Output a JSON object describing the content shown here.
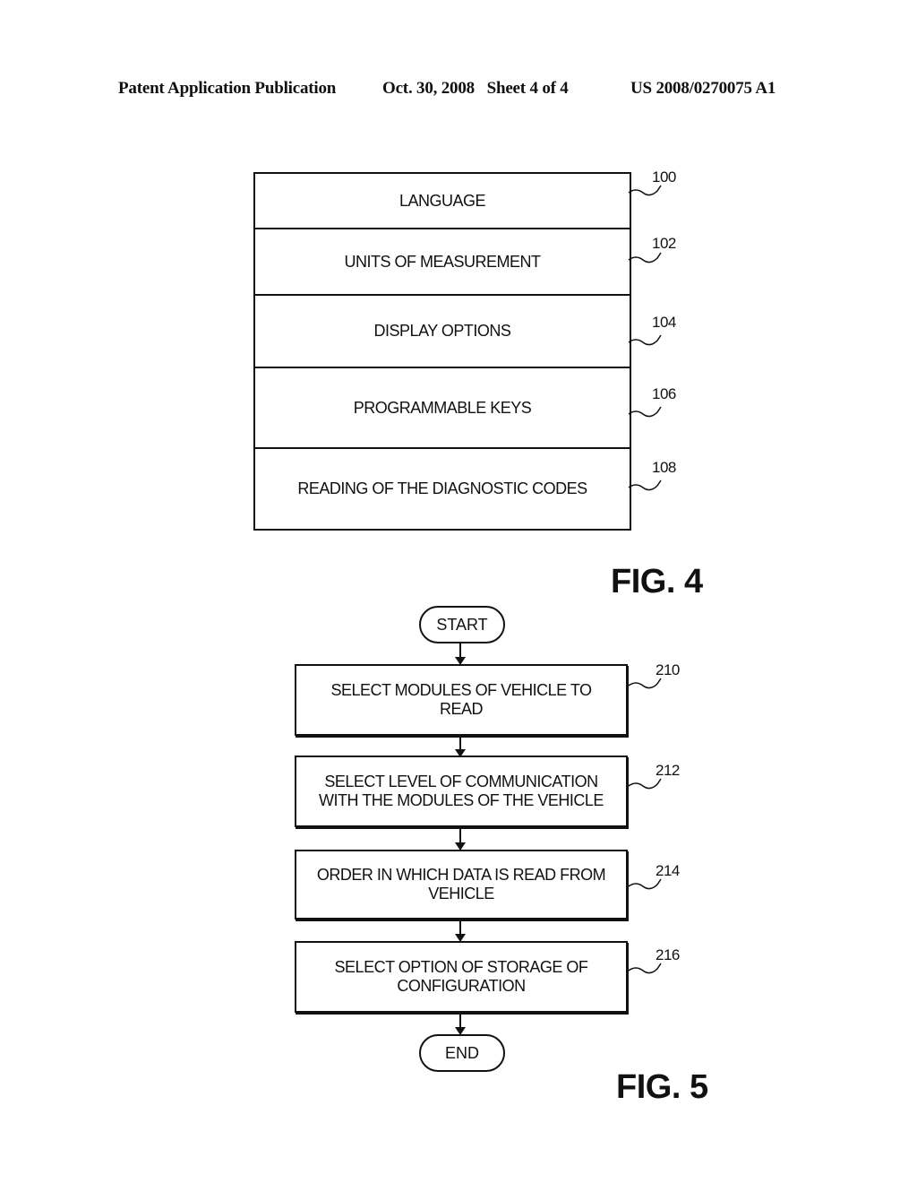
{
  "header": {
    "publication": "Patent Application Publication",
    "date_sheet": "Oct. 30, 2008   Sheet 4 of 4",
    "number": "US 2008/0270075 A1"
  },
  "fig4": {
    "label": "FIG. 4",
    "rows": [
      {
        "text": "LANGUAGE",
        "ref": "100"
      },
      {
        "text": "UNITS OF MEASUREMENT",
        "ref": "102"
      },
      {
        "text": "DISPLAY OPTIONS",
        "ref": "104"
      },
      {
        "text": "PROGRAMMABLE KEYS",
        "ref": "106"
      },
      {
        "text": "READING OF THE DIAGNOSTIC CODES",
        "ref": "108"
      }
    ]
  },
  "fig5": {
    "label": "FIG. 5",
    "start": "START",
    "end": "END",
    "steps": [
      {
        "text": "SELECT MODULES OF VEHICLE TO READ",
        "ref": "210"
      },
      {
        "text": "SELECT LEVEL OF COMMUNICATION WITH THE MODULES OF THE VEHICLE",
        "ref": "212"
      },
      {
        "text": "ORDER IN WHICH DATA IS READ FROM VEHICLE",
        "ref": "214"
      },
      {
        "text": "SELECT OPTION OF STORAGE OF CONFIGURATION",
        "ref": "216"
      }
    ]
  }
}
